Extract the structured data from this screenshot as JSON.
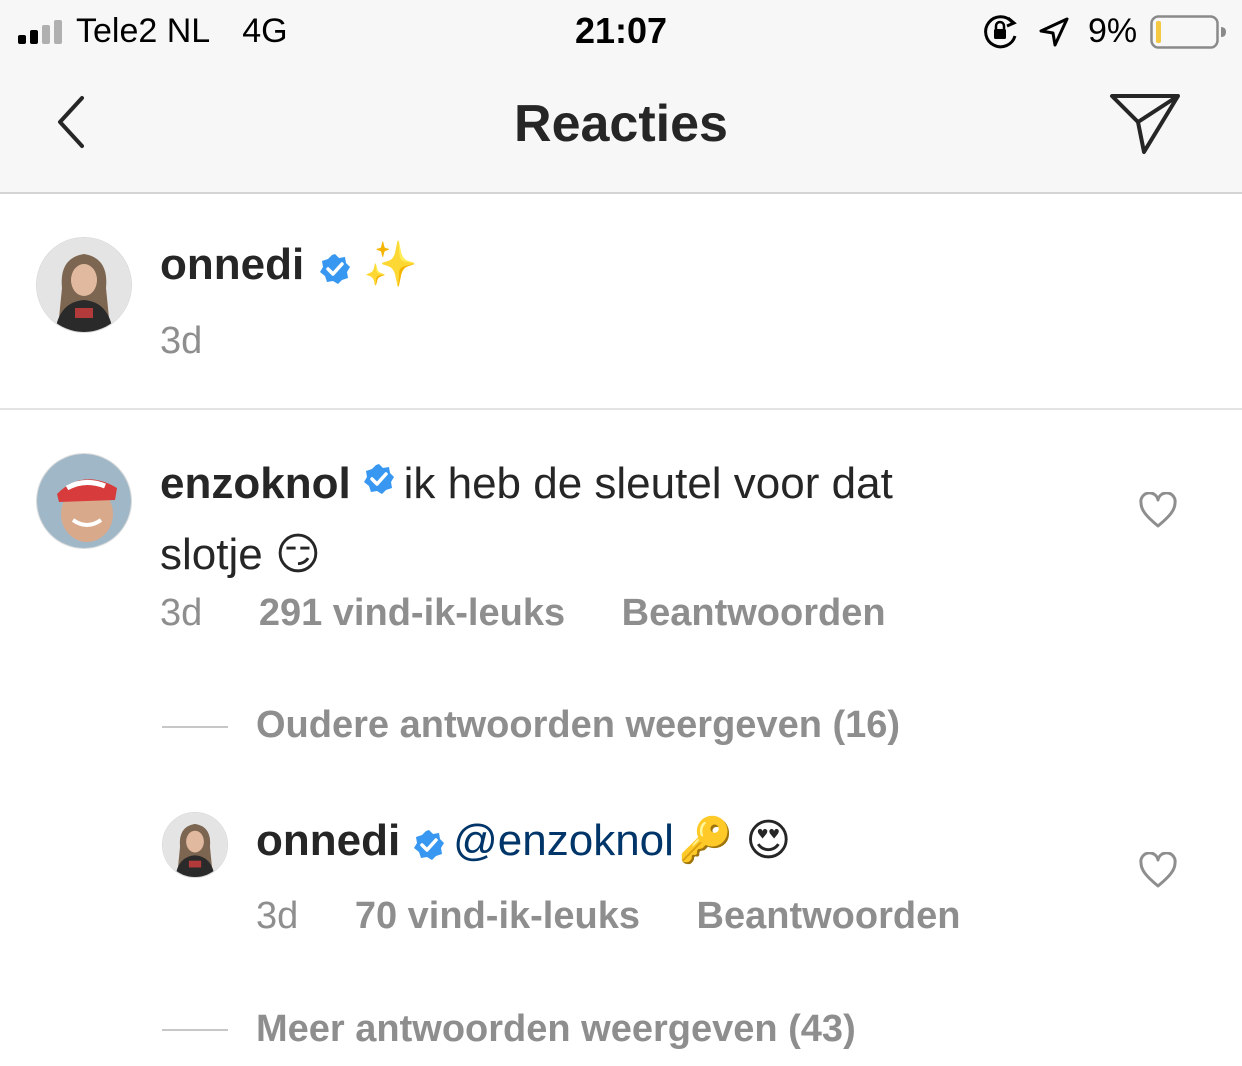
{
  "status": {
    "carrier": "Tele2 NL",
    "network": "4G",
    "time": "21:07",
    "battery_percent": "9%",
    "battery_level": 0.09,
    "battery_color": "#f5c842"
  },
  "header": {
    "title": "Reacties",
    "back_icon": "chevron-left-icon",
    "share_icon": "paper-plane-icon"
  },
  "caption": {
    "username": "onnedi",
    "text": "✨",
    "age": "3d"
  },
  "comment": {
    "username": "enzoknol",
    "text_line1": "ik heb de sleutel voor dat",
    "text_line2": "slotje 😏",
    "age": "3d",
    "likes": "291 vind-ik-leuks",
    "reply_label": "Beantwoorden"
  },
  "older_replies": "Oudere antwoorden weergeven (16)",
  "reply": {
    "username": "onnedi",
    "mention": "@enzoknol",
    "emojis": "🔑 😍",
    "age": "3d",
    "likes": "70 vind-ik-leuks",
    "reply_label": "Beantwoorden"
  },
  "more_replies": "Meer antwoorden weergeven (43)",
  "colors": {
    "verified": "#3897f0",
    "link": "#003569",
    "meta": "#8e8e8e"
  }
}
